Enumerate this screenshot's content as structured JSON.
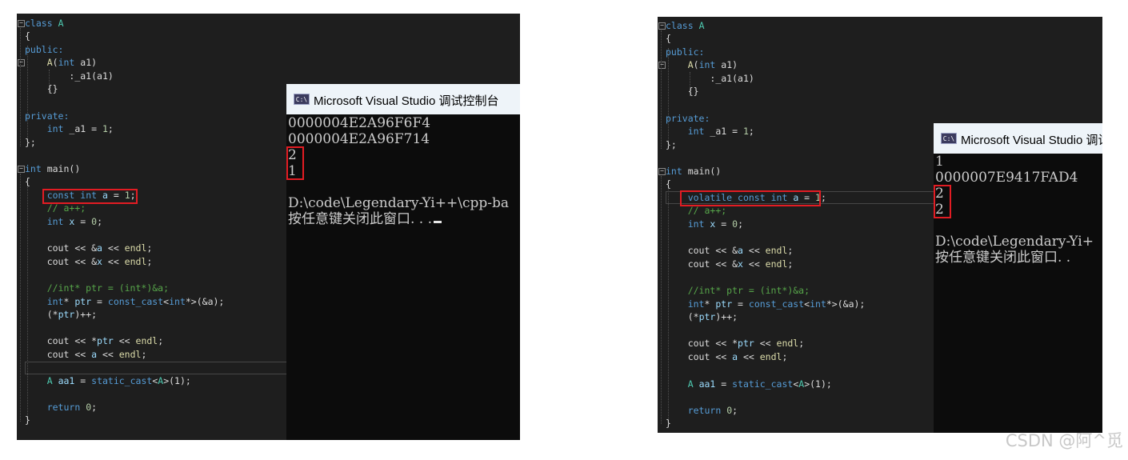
{
  "left_panel": {
    "code": {
      "line_class": [
        "class",
        "A"
      ],
      "line_open1": "{",
      "line_public": "public:",
      "line_ctor": [
        "A",
        "(",
        "int",
        " a1)"
      ],
      "line_init": [
        ":_a1",
        "(a1)"
      ],
      "line_ctor_body": "{}",
      "line_private": "private:",
      "line_member": [
        "int",
        " _a1 = ",
        "1",
        ";"
      ],
      "line_close1": "};",
      "line_main": [
        "int",
        " main()"
      ],
      "line_open2": "{",
      "line_decl": [
        "const",
        " ",
        "int",
        " ",
        "a",
        " = ",
        "1",
        ";"
      ],
      "line_comment1": "// a++;",
      "line_x": [
        "int",
        " ",
        "x",
        " = ",
        "0",
        ";"
      ],
      "line_cout_a": [
        "cout",
        " << &",
        "a",
        " << ",
        "endl",
        ";"
      ],
      "line_cout_x": [
        "cout",
        " << &",
        "x",
        " << ",
        "endl",
        ";"
      ],
      "line_comment2": "//int* ptr = (int*)&a;",
      "line_ptr": [
        "int",
        "* ",
        "ptr",
        " = ",
        "const_cast",
        "<",
        "int",
        "*>(&a);"
      ],
      "line_inc": [
        "(*",
        "ptr",
        ")++;"
      ],
      "line_cout_ptr": [
        "cout",
        " << *",
        "ptr",
        " << ",
        "endl",
        ";"
      ],
      "line_cout_a2": [
        "cout",
        " << ",
        "a",
        " << ",
        "endl",
        ";"
      ],
      "line_aa1": [
        "A",
        " ",
        "aa1",
        " = ",
        "static_cast",
        "<",
        "A",
        ">(1);"
      ],
      "line_return": [
        "return",
        " ",
        "0",
        ";"
      ],
      "line_close2": "}"
    },
    "console": {
      "title": "Microsoft Visual Studio 调试控制台",
      "icon_text": "C:\\",
      "lines": [
        "0000004E2A96F6F4",
        "0000004E2A96F714",
        "2",
        "1",
        "",
        "D:\\code\\Legendary-Yi++\\cpp-ba",
        "按任意键关闭此窗口. . ."
      ]
    }
  },
  "right_panel": {
    "code": {
      "line_class": [
        "class",
        "A"
      ],
      "line_open1": "{",
      "line_public": "public:",
      "line_ctor": [
        "A",
        "(",
        "int",
        " a1)"
      ],
      "line_init": [
        ":_a1",
        "(a1)"
      ],
      "line_ctor_body": "{}",
      "line_private": "private:",
      "line_member": [
        "int",
        " _a1 = ",
        "1",
        ";"
      ],
      "line_close1": "};",
      "line_main": [
        "int",
        " main()"
      ],
      "line_open2": "{",
      "line_decl": [
        "volatile",
        " ",
        "const",
        " ",
        "int",
        " ",
        "a",
        " = ",
        "1",
        ";"
      ],
      "line_comment1": "// a++;",
      "line_x": [
        "int",
        " ",
        "x",
        " = ",
        "0",
        ";"
      ],
      "line_cout_a": [
        "cout",
        " << &",
        "a",
        " << ",
        "endl",
        ";"
      ],
      "line_cout_x": [
        "cout",
        " << &",
        "x",
        " << ",
        "endl",
        ";"
      ],
      "line_comment2": "//int* ptr = (int*)&a;",
      "line_ptr": [
        "int",
        "* ",
        "ptr",
        " = ",
        "const_cast",
        "<",
        "int",
        "*>(&a);"
      ],
      "line_inc": [
        "(*",
        "ptr",
        ")++;"
      ],
      "line_cout_ptr": [
        "cout",
        " << *",
        "ptr",
        " << ",
        "endl",
        ";"
      ],
      "line_cout_a2": [
        "cout",
        " << ",
        "a",
        " << ",
        "endl",
        ";"
      ],
      "line_aa1": [
        "A",
        " ",
        "aa1",
        " = ",
        "static_cast",
        "<",
        "A",
        ">(1);"
      ],
      "line_return": [
        "return",
        " ",
        "0",
        ";"
      ],
      "line_close2": "}"
    },
    "console": {
      "title": "Microsoft Visual Studio 调试",
      "icon_text": "C:\\",
      "lines": [
        "1",
        "0000007E9417FAD4",
        "2",
        "2",
        "",
        "D:\\code\\Legendary-Yi+",
        "按任意键关闭此窗口. ."
      ]
    }
  },
  "watermark": "CSDN @阿^觅",
  "colors": {
    "editor_bg": "#1e1e1e",
    "console_bg": "#0c0c0c",
    "highlight_box": "#e21c23",
    "keyword": "#569cd6"
  }
}
